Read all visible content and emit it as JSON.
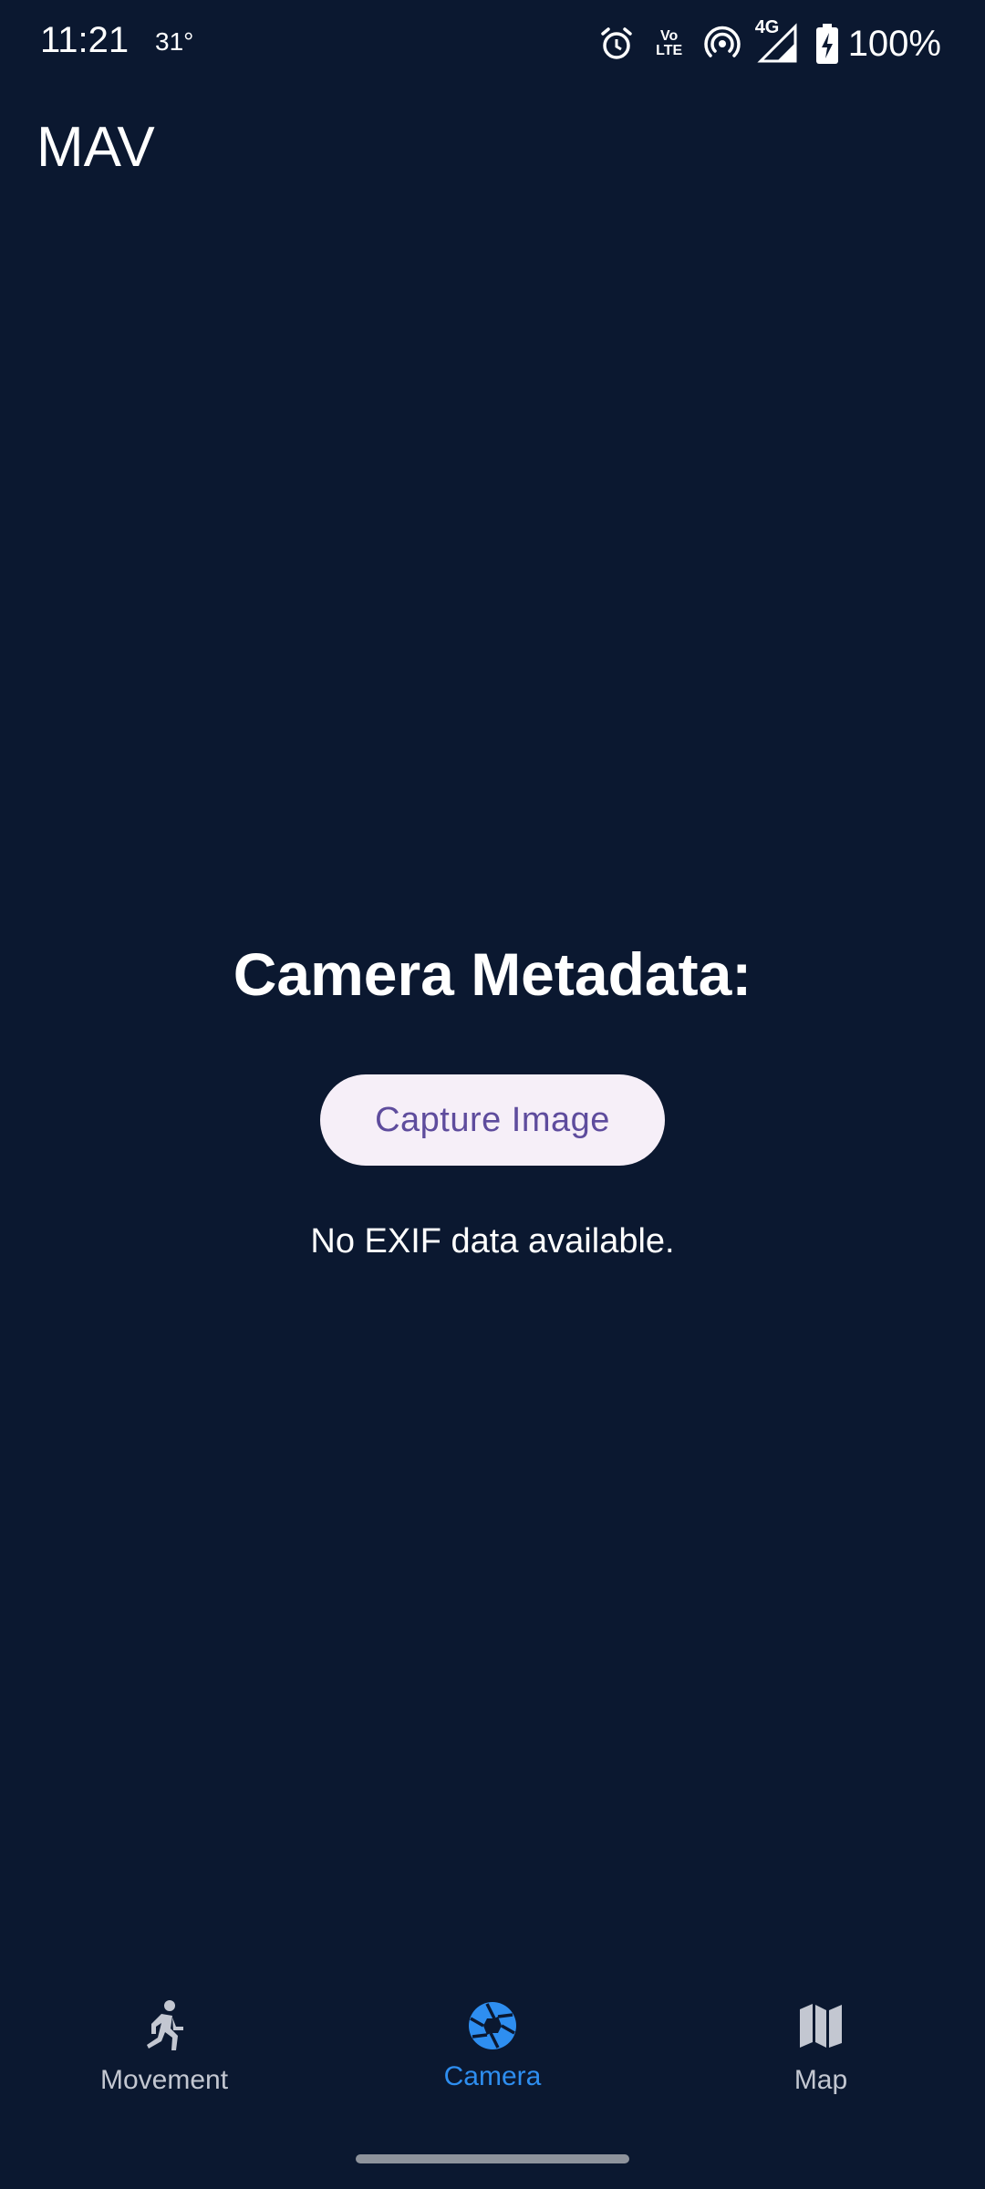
{
  "status_bar": {
    "time": "11:21",
    "temperature": "31°",
    "network": "4G",
    "volte": "Vo LTE",
    "battery": "100%",
    "icons": [
      "alarm-icon",
      "volte-icon",
      "hotspot-icon",
      "signal-icon",
      "battery-charging-icon"
    ]
  },
  "app_bar": {
    "title": "MAV"
  },
  "main": {
    "title": "Camera Metadata:",
    "capture_button_label": "Capture Image",
    "exif_status": "No EXIF data available."
  },
  "bottom_nav": {
    "items": [
      {
        "label": "Movement",
        "icon": "running-person-icon",
        "active": false
      },
      {
        "label": "Camera",
        "icon": "camera-shutter-icon",
        "active": true
      },
      {
        "label": "Map",
        "icon": "map-icon",
        "active": false
      }
    ]
  },
  "colors": {
    "background": "#0b1830",
    "accent": "#2e8ef0",
    "button_bg": "#f6eff8",
    "button_text": "#5e4c9d",
    "inactive": "#c3c7d1"
  }
}
